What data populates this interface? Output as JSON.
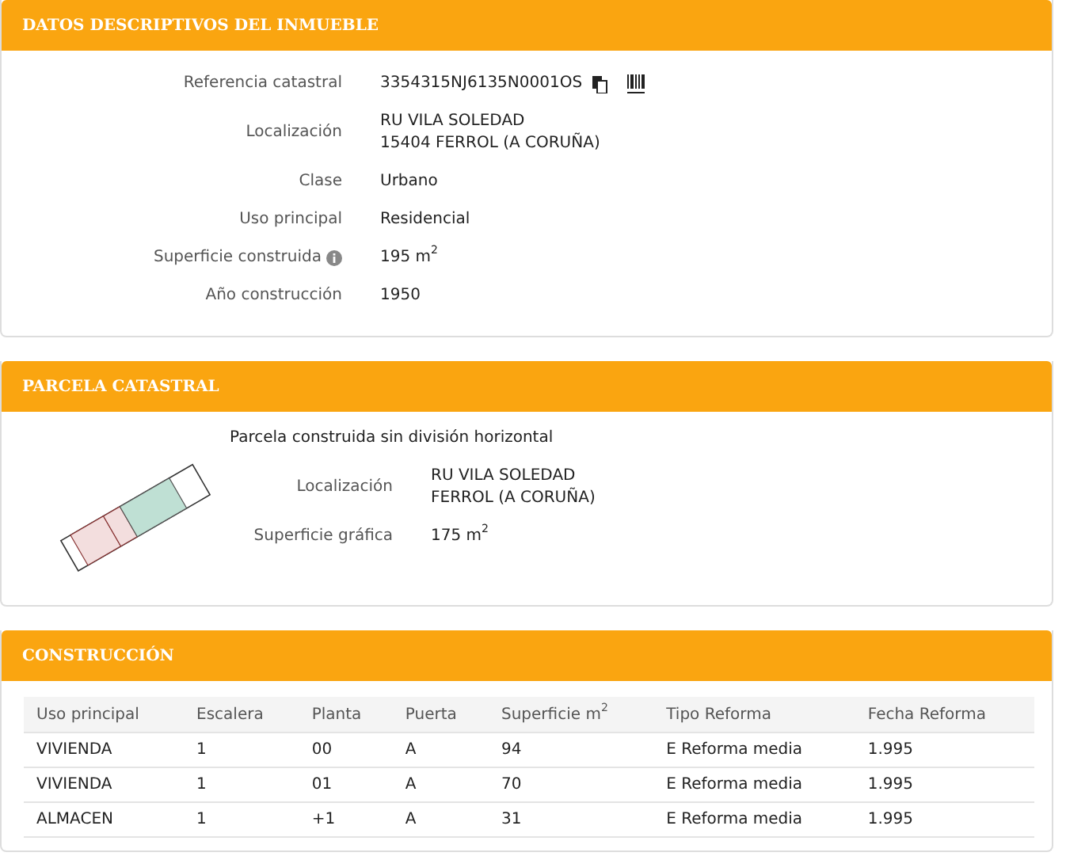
{
  "datos": {
    "title": "DATOS DESCRIPTIVOS DEL INMUEBLE",
    "rows": [
      {
        "label": "Referencia catastral",
        "lines": [
          "3354315NJ6135N0001OS"
        ],
        "kind": "reference"
      },
      {
        "label": "Localización",
        "lines": [
          "RU VILA SOLEDAD",
          "15404 FERROL (A CORUÑA)"
        ],
        "kind": "plain"
      },
      {
        "label": "Clase",
        "lines": [
          "Urbano"
        ],
        "kind": "plain"
      },
      {
        "label": "Uso principal",
        "lines": [
          "Residencial"
        ],
        "kind": "plain"
      },
      {
        "label": "Superficie construida",
        "lines": [
          "195 m$^{2}$"
        ],
        "kind": "info"
      },
      {
        "label": "Año construcción",
        "lines": [
          "1950"
        ],
        "kind": "plain"
      }
    ]
  },
  "parcela": {
    "title": "PARCELA CATASTRAL",
    "description": "Parcela construida sin división horizontal",
    "rows": [
      {
        "label": "Localización",
        "lines": [
          "RU VILA SOLEDAD",
          "FERROL (A CORUÑA)"
        ]
      },
      {
        "label": "Superficie gráfica",
        "lines": [
          "175 m$^{2}$"
        ]
      }
    ]
  },
  "construccion": {
    "title": "CONSTRUCCIÓN",
    "columns": [
      "Uso principal",
      "Escalera",
      "Planta",
      "Puerta",
      "Superficie m$^{2}$",
      "Tipo Reforma",
      "Fecha Reforma"
    ],
    "rows": [
      [
        "VIVIENDA",
        "1",
        "00",
        "A",
        "94",
        "E Reforma media",
        "1.995"
      ],
      [
        "VIVIENDA",
        "1",
        "01",
        "A",
        "70",
        "E Reforma media",
        "1.995"
      ],
      [
        "ALMACEN",
        "1",
        "+1",
        "A",
        "31",
        "E Reforma media",
        "1.995"
      ]
    ]
  }
}
